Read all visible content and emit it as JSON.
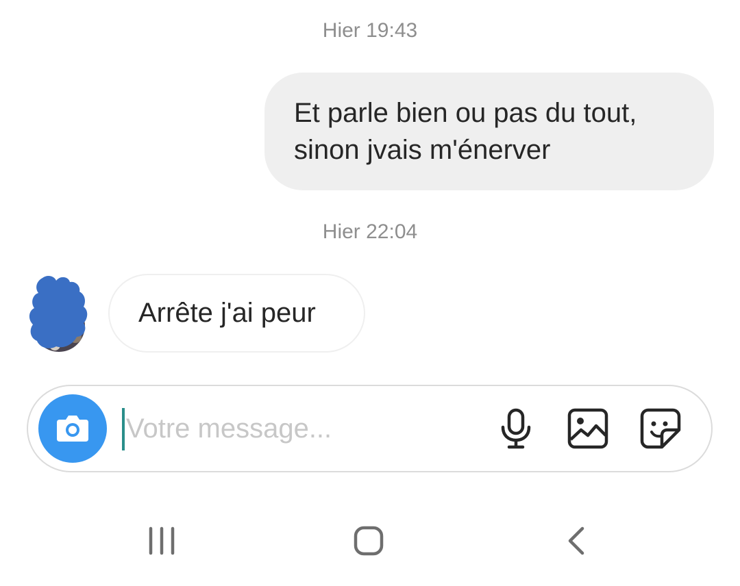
{
  "conversation": {
    "timestamp_1": "Hier 19:43",
    "outgoing_message": {
      "line_1": "Et parle bien ou pas du tout,",
      "line_2": "sinon jvais m'énerver"
    },
    "timestamp_2": "Hier 22:04",
    "incoming_message": "Arrête j'ai peur"
  },
  "composer": {
    "placeholder": "Votre message...",
    "value": "",
    "icons": [
      "camera-icon",
      "microphone-icon",
      "image-icon",
      "sticker-icon"
    ]
  },
  "navigation_bar": {
    "icons": [
      "recent-apps-icon",
      "home-icon",
      "back-icon"
    ]
  },
  "colors": {
    "accent": "#3897f0",
    "outgoing_bubble": "#efefef",
    "timestamp_text": "#8e8e8e",
    "placeholder_text": "#c7c7c7",
    "cursor": "#2a8e8a",
    "avatar_scribble": "#3a6fc4"
  }
}
